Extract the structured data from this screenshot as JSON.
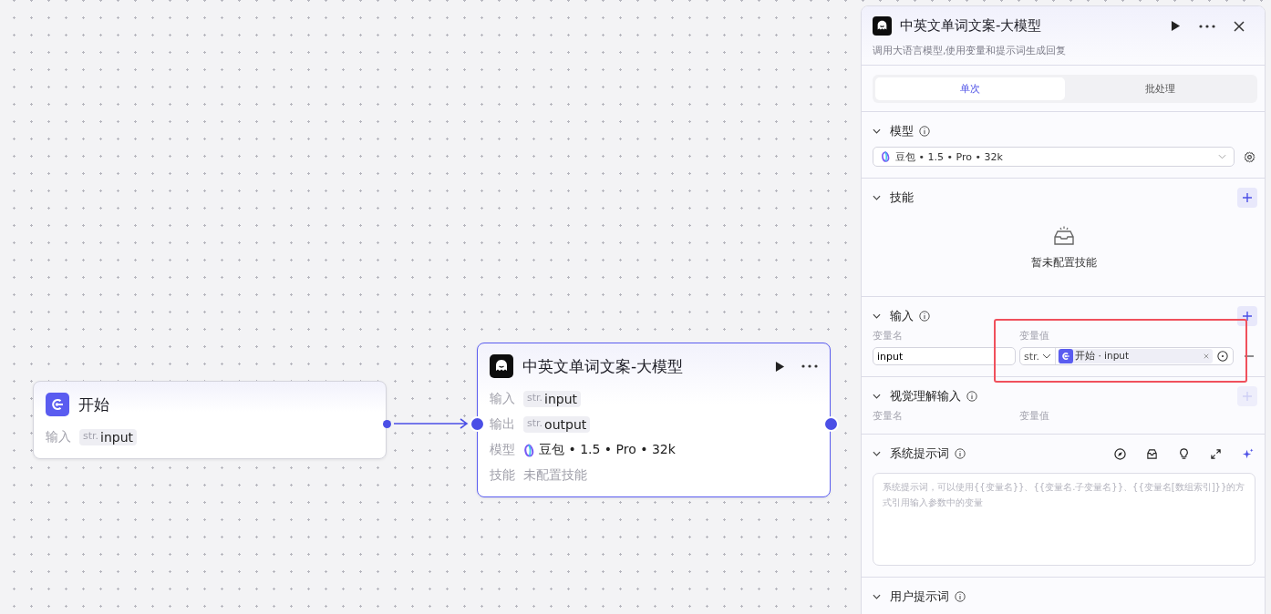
{
  "canvas": {
    "nodes": [
      {
        "kind": "start",
        "title": "开始",
        "actions": false,
        "rows": [
          {
            "kind": "var",
            "label": "输入",
            "type": "str.",
            "value": "input"
          }
        ]
      },
      {
        "kind": "llm",
        "title": "中英文单词文案-大模型",
        "actions": true,
        "rows": [
          {
            "kind": "var",
            "label": "输入",
            "type": "str.",
            "value": "input"
          },
          {
            "kind": "var",
            "label": "输出",
            "type": "str.",
            "value": "output"
          },
          {
            "kind": "model",
            "label": "模型",
            "value": "豆包 • 1.5 • Pro • 32k"
          },
          {
            "kind": "muted",
            "label": "技能",
            "value": "未配置技能"
          }
        ]
      }
    ]
  },
  "panel": {
    "title": "中英文单词文案-大模型",
    "description": "调用大语言模型,使用变量和提示词生成回复",
    "tabs": [
      {
        "label": "单次",
        "selected": true
      },
      {
        "label": "批处理",
        "selected": false
      }
    ],
    "sections": [
      {
        "kind": "model",
        "title": "模型",
        "info": true,
        "expanded": true,
        "model": "豆包 • 1.5 • Pro • 32k"
      },
      {
        "kind": "skills",
        "title": "技能",
        "info": false,
        "expanded": true,
        "add": {
          "disabled": false
        },
        "empty": "暂未配置技能"
      },
      {
        "kind": "vars",
        "title": "输入",
        "info": true,
        "expanded": true,
        "add": {
          "disabled": false
        },
        "columns": [
          "变量名",
          "变量值"
        ],
        "rows": [
          {
            "name": "input",
            "type": "str.",
            "reference": "开始 · input",
            "highlighted": true
          }
        ]
      },
      {
        "kind": "vars",
        "title": "视觉理解输入",
        "info": true,
        "expanded": true,
        "add": {
          "disabled": true
        },
        "columns": [
          "变量名",
          "变量值"
        ]
      },
      {
        "kind": "prompt",
        "title": "系统提示词",
        "info": true,
        "expanded": true,
        "placeholder": "系统提示词，可以使用{{变量名}}、{{变量名.子变量名}}、{{变量名[数组索引]}}的方式引用输入参数中的变量"
      },
      {
        "kind": "header",
        "title": "用户提示词",
        "info": true,
        "expanded": true
      }
    ]
  }
}
